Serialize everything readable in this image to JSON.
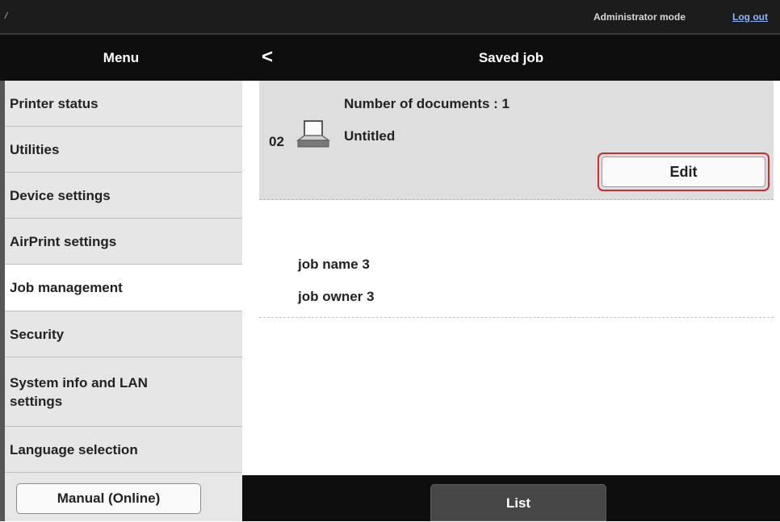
{
  "topbar": {
    "slash": "/",
    "mode": "Administrator mode",
    "logout": "Log out"
  },
  "header": {
    "menu_title": "Menu",
    "back": "<",
    "page_title": "Saved job"
  },
  "sidebar": {
    "items": [
      {
        "label": "Printer status"
      },
      {
        "label": "Utilities"
      },
      {
        "label": "Device settings"
      },
      {
        "label": "AirPrint settings"
      },
      {
        "label": "Job management",
        "active": true
      },
      {
        "label": "Security"
      },
      {
        "label": "System info and LAN settings"
      },
      {
        "label": "Language selection"
      }
    ],
    "manual_button": "Manual (Online)"
  },
  "jobs": [
    {
      "number": "02",
      "icon": "document-tray-icon",
      "count_text": "Number of documents : 1",
      "name": "Untitled",
      "edit_label": "Edit"
    },
    {
      "name": "job name 3",
      "owner": "job owner 3"
    }
  ],
  "footer": {
    "list_label": "List"
  },
  "colors": {
    "dark_bar": "#0e0e0e",
    "highlight": "#d62b2b",
    "sidebar_bg": "#e6e6e6",
    "job_bg": "#dedede"
  }
}
